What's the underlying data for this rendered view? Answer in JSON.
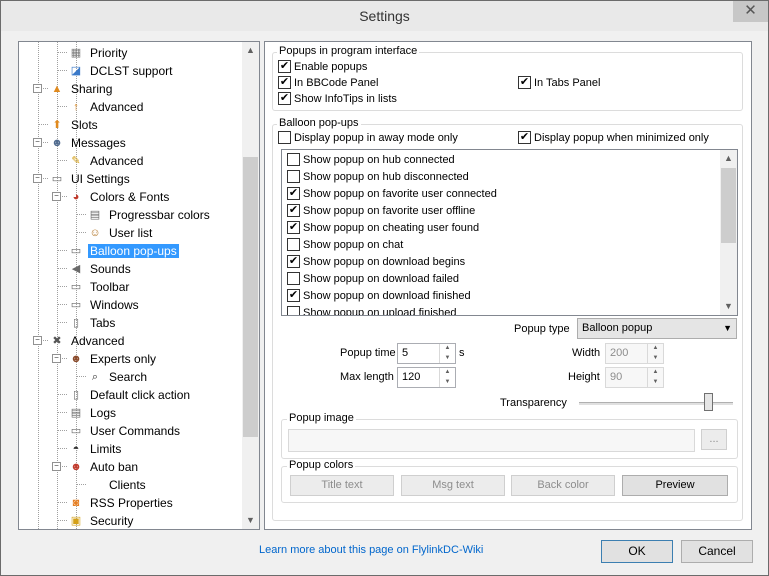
{
  "window": {
    "title": "Settings",
    "close_glyph": "✕"
  },
  "tree": {
    "items": [
      {
        "label": "Priority",
        "icon": "priority-icon",
        "glyph": "▦",
        "color": "#7a7a7a"
      },
      {
        "label": "DCLST support",
        "icon": "dclst-icon",
        "glyph": "◪",
        "color": "#3a79c9"
      },
      {
        "label": "Sharing",
        "icon": "sharing-icon",
        "glyph": "▲",
        "color": "#e08a1e"
      },
      {
        "label": "Advanced",
        "icon": "advanced-sharing-icon",
        "glyph": "↑",
        "color": "#e08a1e"
      },
      {
        "label": "Slots",
        "icon": "slots-icon",
        "glyph": "⬆",
        "color": "#e08a1e"
      },
      {
        "label": "Messages",
        "icon": "messages-icon",
        "glyph": "☻",
        "color": "#4f6a8e"
      },
      {
        "label": "Advanced",
        "icon": "advanced-messages-icon",
        "glyph": "✎",
        "color": "#d4a017"
      },
      {
        "label": "UI Settings",
        "icon": "ui-settings-icon",
        "glyph": "▭",
        "color": "#6a6a6a"
      },
      {
        "label": "Colors & Fonts",
        "icon": "palette-icon",
        "glyph": "◕",
        "color": "#c0392b"
      },
      {
        "label": "Progressbar colors",
        "icon": "progressbar-icon",
        "glyph": "▤",
        "color": "#6a6a6a"
      },
      {
        "label": "User list",
        "icon": "user-list-icon",
        "glyph": "☺",
        "color": "#b07020"
      },
      {
        "label": "Balloon pop-ups",
        "icon": "balloon-icon",
        "glyph": "▭",
        "color": "#6a6a6a"
      },
      {
        "label": "Sounds",
        "icon": "sounds-icon",
        "glyph": "◀",
        "color": "#6a6a6a"
      },
      {
        "label": "Toolbar",
        "icon": "toolbar-icon",
        "glyph": "▭",
        "color": "#6a6a6a"
      },
      {
        "label": "Windows",
        "icon": "windows-icon",
        "glyph": "▭",
        "color": "#6a6a6a"
      },
      {
        "label": "Tabs",
        "icon": "tabs-icon",
        "glyph": "▯",
        "color": "#6a6a6a"
      },
      {
        "label": "Advanced",
        "icon": "tools-icon",
        "glyph": "✖",
        "color": "#555555"
      },
      {
        "label": "Experts only",
        "icon": "expert-icon",
        "glyph": "☻",
        "color": "#8a4a2a"
      },
      {
        "label": "Search",
        "icon": "search-icon",
        "glyph": "⌕",
        "color": "#333333"
      },
      {
        "label": "Default click action",
        "icon": "mouse-icon",
        "glyph": "▯",
        "color": "#6a6a6a"
      },
      {
        "label": "Logs",
        "icon": "logs-icon",
        "glyph": "▤",
        "color": "#6a6a6a"
      },
      {
        "label": "User Commands",
        "icon": "user-commands-icon",
        "glyph": "▭",
        "color": "#6a6a6a"
      },
      {
        "label": "Limits",
        "icon": "limits-icon",
        "glyph": "◓",
        "color": "#333333"
      },
      {
        "label": "Auto ban",
        "icon": "auto-ban-icon",
        "glyph": "☻",
        "color": "#c0392b"
      },
      {
        "label": "Clients",
        "icon": "",
        "glyph": "",
        "color": "#000000"
      },
      {
        "label": "RSS Properties",
        "icon": "rss-icon",
        "glyph": "◙",
        "color": "#e67e22"
      },
      {
        "label": "Security",
        "icon": "security-icon",
        "glyph": "▣",
        "color": "#d4a017"
      }
    ]
  },
  "popups_interface": {
    "label": "Popups in program interface",
    "enable_popups": "Enable popups",
    "in_bbcode_panel": "In BBCode Panel",
    "in_tabs_panel": "In Tabs Panel",
    "show_infotips": "Show InfoTips in lists"
  },
  "balloon": {
    "label": "Balloon pop-ups",
    "away_mode": "Display popup in away mode only",
    "when_minimized": "Display popup when minimized only",
    "list": [
      {
        "label": "Show popup on hub connected",
        "checked": false
      },
      {
        "label": "Show popup on hub disconnected",
        "checked": false
      },
      {
        "label": "Show popup on favorite user connected",
        "checked": true
      },
      {
        "label": "Show popup on favorite user offline",
        "checked": true
      },
      {
        "label": "Show popup on cheating user found",
        "checked": true
      },
      {
        "label": "Show popup on chat",
        "checked": false
      },
      {
        "label": "Show popup on download begins",
        "checked": true
      },
      {
        "label": "Show popup on download failed",
        "checked": false
      },
      {
        "label": "Show popup on download finished",
        "checked": true
      },
      {
        "label": "Show popup on upload finished",
        "checked": false
      }
    ],
    "popup_type_label": "Popup type",
    "popup_type_value": "Balloon popup",
    "popup_time_label": "Popup time",
    "popup_time_value": "5",
    "popup_time_unit": "s",
    "max_length_label": "Max length",
    "max_length_value": "120",
    "width_label": "Width",
    "width_value": "200",
    "height_label": "Height",
    "height_value": "90",
    "transparency_label": "Transparency",
    "transparency_level": 0.84
  },
  "popup_image": {
    "label": "Popup image",
    "browse": "..."
  },
  "popup_colors": {
    "label": "Popup colors",
    "title_text": "Title text",
    "msg_text": "Msg text",
    "back_color": "Back color",
    "preview": "Preview"
  },
  "footer": {
    "link": "Learn more about this page on FlylinkDC-Wiki",
    "ok": "OK",
    "cancel": "Cancel"
  }
}
